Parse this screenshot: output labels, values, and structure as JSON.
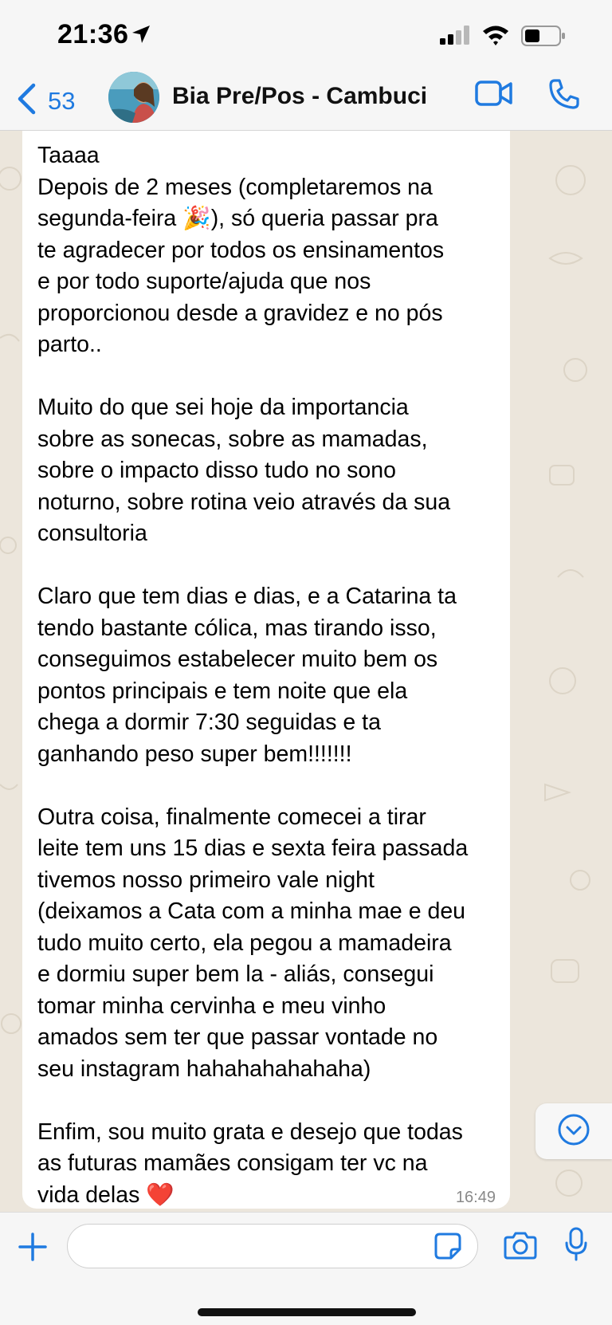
{
  "status_bar": {
    "time": "21:36"
  },
  "header": {
    "back_count": "53",
    "contact_name": "Bia Pre/Pos - Cambuci"
  },
  "message": {
    "lines": [
      "Taaaa",
      "Depois de 2 meses (completaremos na",
      "segunda-feira 🎉), só queria passar pra",
      "te agradecer por todos os ensinamentos",
      "e por todo suporte/ajuda que nos",
      "proporcionou desde a gravidez e no pós",
      "parto..",
      "",
      "Muito do que sei hoje da importancia",
      "sobre as sonecas, sobre as mamadas,",
      "sobre o impacto disso tudo no sono",
      "noturno, sobre rotina veio através da sua",
      "consultoria",
      "",
      "Claro que tem dias e dias, e a Catarina ta",
      "tendo bastante cólica, mas tirando isso,",
      "conseguimos estabelecer muito bem os",
      "pontos principais e tem noite que ela",
      "chega a dormir 7:30 seguidas e ta",
      "ganhando peso super bem!!!!!!!",
      "",
      "Outra coisa, finalmente comecei a tirar",
      "leite tem uns 15 dias e sexta feira passada",
      "tivemos nosso primeiro vale night",
      "(deixamos a Cata com a minha mae e deu",
      "tudo muito certo, ela pegou a mamadeira",
      "e dormiu super bem la - aliás, consegui",
      "tomar minha cervinha e meu vinho",
      "amados sem ter que passar vontade no",
      "seu instagram hahahahahahaha)",
      "",
      "Enfim, sou muito grata e desejo que todas",
      "as futuras mamães consigam ter vc na",
      "vida delas ❤️"
    ],
    "time": "16:49"
  },
  "input": {
    "value": "",
    "placeholder": ""
  },
  "icons": {
    "accent_color": "#1f7ae0",
    "back": "chevron-left-icon",
    "video": "video-camera-icon",
    "phone": "phone-icon",
    "plus": "plus-icon",
    "sticker": "sticker-icon",
    "camera": "camera-icon",
    "mic": "microphone-icon",
    "scroll_down": "chevron-down-circle-icon"
  }
}
